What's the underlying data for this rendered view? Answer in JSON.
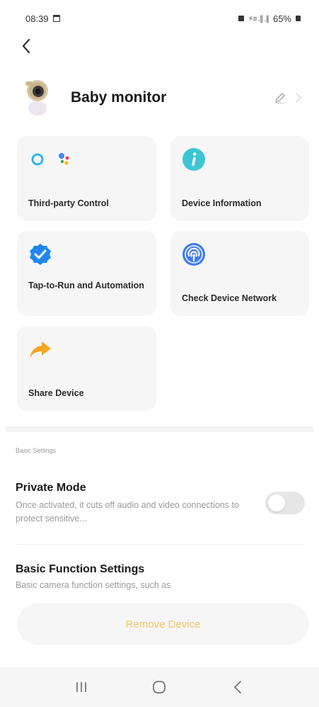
{
  "status_bar": {
    "time": "08:39",
    "signal_text": "⚡≡ .∥ .∥",
    "battery": "65%"
  },
  "device": {
    "name": "Baby monitor"
  },
  "cards": [
    {
      "label": "Third-party Control",
      "icon": "alexa-google-assistant-icon"
    },
    {
      "label": "Device Information",
      "icon": "info-icon"
    },
    {
      "label": "Tap-to-Run and Automation",
      "icon": "checkmark-badge-icon"
    },
    {
      "label": "Check Device Network",
      "icon": "network-signal-icon"
    },
    {
      "label": "Share Device",
      "icon": "share-arrow-icon"
    }
  ],
  "basic_settings": {
    "section_title": "Basic Settings",
    "private_mode": {
      "title": "Private Mode",
      "description": "Once activated, it cuts off audio and video connections to protect sensitive...",
      "enabled": false
    },
    "basic_function": {
      "title": "Basic Function Settings",
      "description": "Basic camera function settings, such as"
    }
  },
  "remove_button": {
    "label": "Remove Device"
  },
  "colors": {
    "accent_orange": "#f5a623",
    "info_teal": "#3cc6d4",
    "check_blue": "#1e88f0",
    "network_blue": "#3f7cf2"
  }
}
